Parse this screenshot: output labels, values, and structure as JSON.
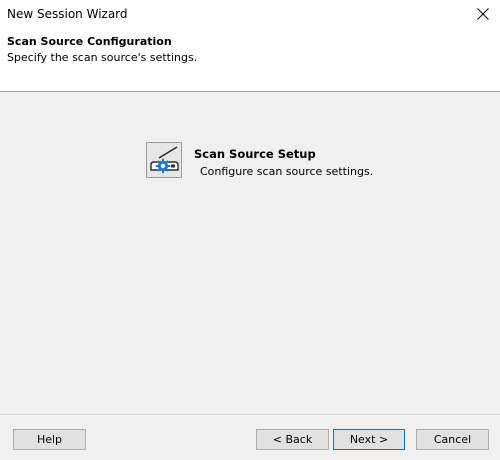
{
  "window": {
    "title": "New Session Wizard",
    "close_icon": "close-icon"
  },
  "header": {
    "title": "Scan Source Configuration",
    "subtitle": "Specify the scan source's settings."
  },
  "content": {
    "icon": "scan-source-gear-icon",
    "title": "Scan Source Setup",
    "description": "Configure scan source settings."
  },
  "footer": {
    "help_label": "Help",
    "back_label": "< Back",
    "next_label": "Next >",
    "cancel_label": "Cancel"
  },
  "colors": {
    "dialog_background": "#f0f0f0",
    "header_background": "#ffffff",
    "default_button_border": "#0078d7",
    "icon_accent": "#1e78d7"
  }
}
